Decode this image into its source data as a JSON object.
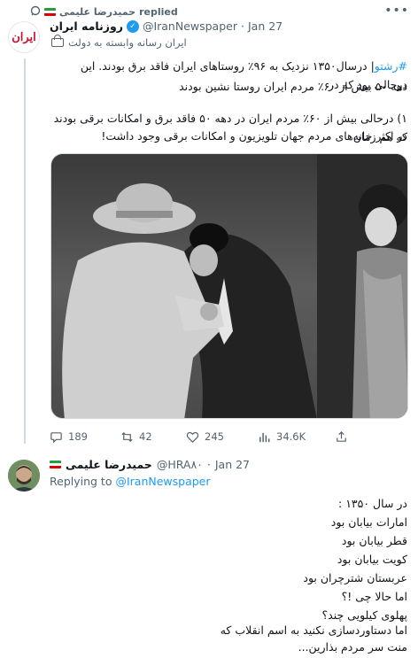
{
  "replied": {
    "user": "حمیدرضا علیمی",
    "label": "replied"
  },
  "menu": {
    "glyph": "•••"
  },
  "tweet1": {
    "avatar_text": "ایران",
    "name": "روزنامه ایران",
    "handle": "@IranNewspaper",
    "sep": "·",
    "date": "Jan 27",
    "affiliation": "ایران رسانه وابسته به دولت",
    "hashtag": "#رشتو",
    "body_line1_rest": "| درسال۱۳۵۰ نزدیک به ۹۶٪ روستاهای ایران فاقد برق بودند. این درحالی بود که در",
    "body_line2": "دهه ۵۰ بیش از ۶۰٪ مردم ایران روستا نشین بودند",
    "body_line3": "۱) درحالی بیش از ۶۰٪ مردم ایران در دهه ۵۰ فاقد برق و امکانات برقی بودند که هم زمان",
    "body_line4": "در اکثر خانه‌های مردم جهان تلویزیون و امکانات برقی وجود داشت!",
    "stats": {
      "replies": "189",
      "retweets": "42",
      "likes": "245",
      "views": "34.6K"
    }
  },
  "tweet2": {
    "name": "حمیدرضا علیمی",
    "handle": "@HRA۸۰",
    "sep": "·",
    "date": "Jan 27",
    "replying_prefix": "Replying to",
    "replying_handle": "@IranNewspaper",
    "lines": [
      "در سال ۱۳۵۰ :",
      "امارات بیابان بود",
      "قطر بیابان بود",
      "کویت بیابان بود",
      "عربستان شترچران بود",
      "اما حالا چی !؟",
      "پهلوی کیلویی چند؟",
      "اما دستاوردسازی نکنید به اسم انقلاب که",
      "منت سر مردم بذارین..."
    ]
  },
  "colors": {
    "accent": "#1d9bf0",
    "muted": "#536471",
    "text": "#0f1419"
  },
  "icons": [
    "reply-icon",
    "retweet-icon",
    "like-icon",
    "views-icon",
    "share-icon",
    "verified-icon",
    "government-icon"
  ]
}
